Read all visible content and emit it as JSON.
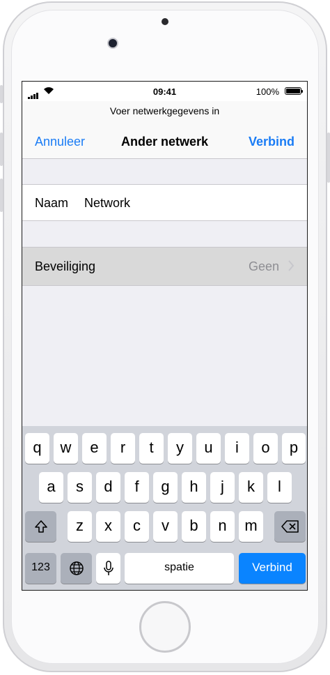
{
  "status_bar": {
    "time": "09:41",
    "battery": "100%"
  },
  "header": {
    "prompt": "Voer netwerkgegevens in",
    "cancel_label": "Annuleer",
    "title": "Ander netwerk",
    "connect_label": "Verbind"
  },
  "form": {
    "name_label": "Naam",
    "name_value": "Network",
    "security_label": "Beveiliging",
    "security_value": "Geen"
  },
  "keyboard": {
    "row1": [
      "q",
      "w",
      "e",
      "r",
      "t",
      "y",
      "u",
      "i",
      "o",
      "p"
    ],
    "row2": [
      "a",
      "s",
      "d",
      "f",
      "g",
      "h",
      "j",
      "k",
      "l"
    ],
    "row3": [
      "z",
      "x",
      "c",
      "v",
      "b",
      "n",
      "m"
    ],
    "numbers_label": "123",
    "space_label": "spatie",
    "return_label": "Verbind"
  },
  "colors": {
    "accent": "#1a7cf5",
    "return_key": "#0a84ff"
  },
  "icons": [
    "signal-icon",
    "wifi-icon",
    "battery-icon",
    "chevron-right-icon",
    "shift-icon",
    "backspace-icon",
    "globe-icon",
    "microphone-icon"
  ]
}
